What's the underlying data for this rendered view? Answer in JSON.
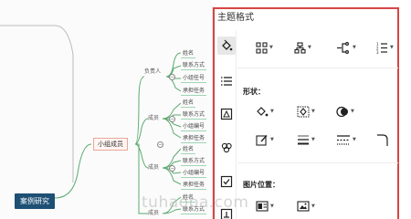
{
  "mindmap": {
    "root": "案例研究",
    "branch": "小组成员",
    "role_leader": "负责人",
    "role_member": "成员",
    "groups": [
      [
        "姓名",
        "联系方式",
        "小组任号",
        "承担任务"
      ],
      [
        "姓名",
        "联系方式",
        "小组编号",
        "承担任务"
      ],
      [
        "姓名",
        "联系方式",
        "小组编号",
        "承担任务"
      ],
      [
        "姓名",
        "联系方式"
      ]
    ]
  },
  "panel": {
    "title": "主题格式",
    "shape_section": "形状：",
    "image_section": "图片位置："
  },
  "watermark": "tuhaoba.com",
  "colors": {
    "panel_border": "#d64545",
    "root_fill": "#1e4f74",
    "branch_line": "#5aaa6f",
    "node_border": "#e9a79a"
  },
  "icons": {
    "sidebar": [
      "paint-bucket-icon",
      "list-icon",
      "image-shape-icon",
      "grape-icon",
      "checkbox-icon",
      "formula-icon"
    ],
    "toolbar_row": [
      "grid-layout-icon",
      "org-structure-icon",
      "connector-icon",
      "numbered-list-icon"
    ],
    "shape_row1": [
      "fill-color-icon",
      "border-shape-icon",
      "shape-style-icon"
    ],
    "shape_row2": [
      "border-color-icon",
      "line-weight-icon",
      "dashed-line-icon",
      "corner-icon"
    ],
    "image_row": [
      "image-left-icon",
      "image-top-icon"
    ]
  }
}
